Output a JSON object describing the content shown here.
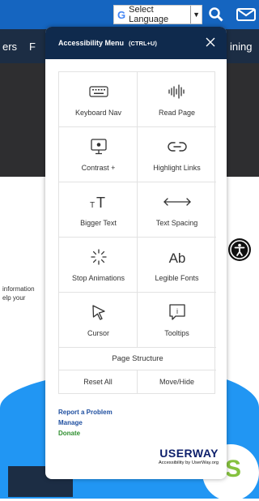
{
  "background": {
    "language_selector": {
      "g_letter": "G",
      "label": "Select Language",
      "caret": "▼"
    },
    "nav_left": "ers",
    "nav_left2": "F",
    "nav_right": "ining",
    "body_text_1": "information",
    "body_text_2": "elp your",
    "logo_partial": "S",
    "colors": {
      "top_bar": "#1565c0",
      "nav_band": "#1c2d44",
      "hero": "#2e2e30",
      "wave": "#2196f3"
    }
  },
  "panel": {
    "title": "Accessibility Menu",
    "shortcut": "(CTRL+U)",
    "close_icon": "close-icon",
    "header_color": "#0f2a4d",
    "features": [
      {
        "label": "Keyboard Nav",
        "icon": "keyboard-icon"
      },
      {
        "label": "Read Page",
        "icon": "audio-wave-icon"
      },
      {
        "label": "Contrast +",
        "icon": "monitor-icon"
      },
      {
        "label": "Highlight Links",
        "icon": "link-icon"
      },
      {
        "label": "Bigger Text",
        "icon": "text-size-icon",
        "glyph": "TT"
      },
      {
        "label": "Text Spacing",
        "icon": "horizontal-arrows-icon",
        "glyph": "⟷"
      },
      {
        "label": "Stop Animations",
        "icon": "spinner-icon"
      },
      {
        "label": "Legible Fonts",
        "icon": "font-icon",
        "glyph": "Ab"
      },
      {
        "label": "Cursor",
        "icon": "cursor-icon"
      },
      {
        "label": "Tooltips",
        "icon": "tooltip-icon",
        "glyph": "i"
      }
    ],
    "page_structure": "Page Structure",
    "reset_all": "Reset All",
    "move_hide": "Move/Hide",
    "links": {
      "report": "Report a Problem",
      "manage": "Manage",
      "donate": "Donate"
    },
    "link_color": "#1f4fa0",
    "donate_color": "#2f8f2f",
    "brand": {
      "name": "USERWAY",
      "tagline": "Accessibility by UserWay.org"
    }
  }
}
